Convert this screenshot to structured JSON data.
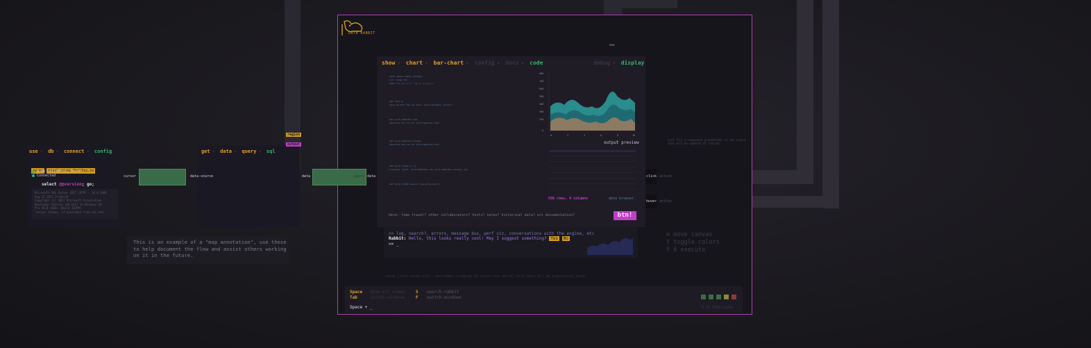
{
  "left_panel": {
    "tabs": [
      "use",
      "db",
      "connect",
      "config"
    ],
    "tag1": "rysmr",
    "tag2": "mssql.azure.fortfox.co",
    "status1": "Auth Validated, Saved",
    "status2": "Connected",
    "query_prefix": "select ",
    "query_var": "@@version",
    "query_suffix": "; go;",
    "output": [
      "Microsoft SQL Server 2017 (RTM) - 14.0.1000",
      "Aug 22 2017 17:04:49",
      "Copyright (C) 2017 Microsoft Corporation",
      "Developer Edition (64-bit) on Windows 10",
      "Pro 10.0 <X64> (Build 16299)",
      "*server status, 17 available from sql-cmd"
    ],
    "port_out": "cursor"
  },
  "mid_panel": {
    "tabs": [
      "get",
      "data",
      "query",
      "sql"
    ],
    "port_in": "data-source",
    "port_out": "data"
  },
  "small_tags": {
    "region": "region",
    "output": "output"
  },
  "logo": {
    "text": "DATA RABBIT"
  },
  "main_panel": {
    "tabs": [
      "show",
      "chart",
      "bar-chart",
      "config",
      "docs",
      "code"
    ],
    "right_tabs": [
      "debug",
      "display"
    ],
    "port_in": "data",
    "port_left": "query",
    "output_preview_label": "output preview",
    "rows_label": "506 rows, 4 columns",
    "data_browser_label": "data browser",
    "bottom_hint": "here: time travel? other collaborators? hosts? notes? historical data? vct documentation?",
    "button": "btn!",
    "y_ticks": [
      "800",
      "700",
      "600",
      "500",
      "400",
      "300",
      "200",
      "0"
    ],
    "x_ticks": [
      "0",
      "2",
      "4",
      "6",
      "8",
      "10"
    ],
    "code_lines": [
      "(defn square-table [offset]",
      "  (->> (range 10)",
      "    (mapv (fn [n] {:n n :sq (* n n)}))))",
      "(def half-a)",
      "\"give me half the ice pool, using decimals (float)\"",
      "(def grid-template-rows",
      "  \"generate the css for grid-template-rows\"",
      "(def grid-template-columns",
      "  \"generate the css for grid-template-cols\"",
      "(def grid-format [r c]",
      "  {:display \"grid\" :grid-template-rows grid-template-columns} out",
      "(def grid-format-square [\"ge grid-area\"])"
    ]
  },
  "console": {
    "line1": ">> log, search?, errors, message bus, perf viz, conversations with the engine, etc",
    "rabbit_label": "Rabbit:",
    "rabbit_text": " Hello, this looks really cool! May I suggest something?",
    "yes": "Yes",
    "no": "No",
    "prompt": ">> _"
  },
  "ports_right": {
    "click": "click",
    "hover": "hover",
    "action1": "action",
    "action2": "action"
  },
  "mini_label_top": "new",
  "right_note": "Just fill a component placeholder in the output that will be updated at runtime",
  "annotation": "This is an example of a \"map annotation\", use these\nto help document the flow and assist others working\non it in the future.",
  "key_hints": [
    "m move canvas",
    "f toggle colors",
    "f 8 execute"
  ],
  "status_line": "canvas | multi window color - when hidden a subgraph the outlet color and all child routes will get progressively darker",
  "bottom_bar": {
    "k1": "Space",
    "k1_desc": "  - show all views",
    "k1b": "S",
    "k1b_desc": "search-rabbit",
    "k2": "Tab",
    "k2_desc": "switch-windows",
    "k2b": "F",
    "k2b_desc": "switch-windows",
    "prompt": "Space + _",
    "version": "0.10.1582 alpha"
  },
  "colors": {
    "frame": "#b13fb3",
    "orange": "#e0a02a",
    "green": "#3bb06e",
    "magenta": "#c03fc6"
  }
}
